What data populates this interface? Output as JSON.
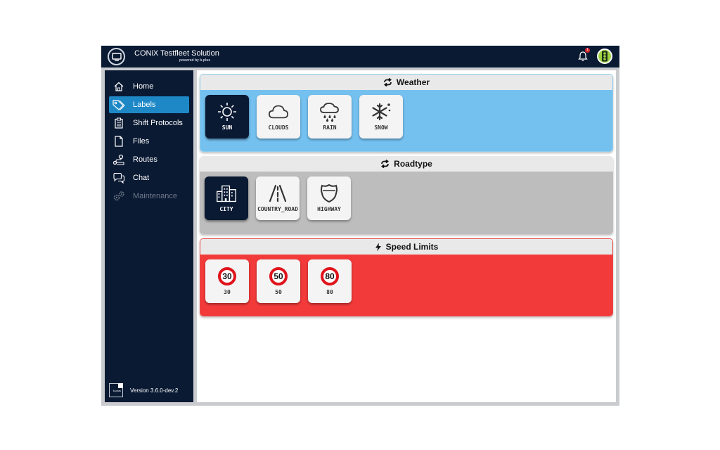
{
  "header": {
    "title": "CONiX Testfleet Solution",
    "subtitle": "powered by b-plus",
    "notification_count": "1"
  },
  "sidebar": {
    "items": [
      {
        "label": "Home",
        "icon": "home-icon",
        "active": false,
        "disabled": false
      },
      {
        "label": "Labels",
        "icon": "tag-icon",
        "active": true,
        "disabled": false
      },
      {
        "label": "Shift Protocols",
        "icon": "clipboard-icon",
        "active": false,
        "disabled": false
      },
      {
        "label": "Files",
        "icon": "file-icon",
        "active": false,
        "disabled": false
      },
      {
        "label": "Routes",
        "icon": "route-icon",
        "active": false,
        "disabled": false
      },
      {
        "label": "Chat",
        "icon": "chat-icon",
        "active": false,
        "disabled": false
      },
      {
        "label": "Maintenance",
        "icon": "gears-icon",
        "active": false,
        "disabled": true
      }
    ],
    "version_logo": "b-plus",
    "version": "Version 3.6.0-dev.2"
  },
  "groups": {
    "weather": {
      "title": "Weather",
      "icon": "sync-icon",
      "color": "#74c1f0",
      "tiles": [
        {
          "label": "SUN",
          "icon": "sun-icon",
          "selected": true
        },
        {
          "label": "CLOUDS",
          "icon": "cloud-icon",
          "selected": false
        },
        {
          "label": "RAIN",
          "icon": "rain-icon",
          "selected": false
        },
        {
          "label": "SNOW",
          "icon": "snow-icon",
          "selected": false
        }
      ]
    },
    "roadtype": {
      "title": "Roadtype",
      "icon": "sync-icon",
      "color": "#bdbdbd",
      "tiles": [
        {
          "label": "CITY",
          "icon": "city-icon",
          "selected": true
        },
        {
          "label": "COUNTRY_ROAD",
          "icon": "road-icon",
          "selected": false
        },
        {
          "label": "HIGHWAY",
          "icon": "highway-shield-icon",
          "selected": false
        }
      ]
    },
    "speed": {
      "title": "Speed Limits",
      "icon": "bolt-icon",
      "color": "#f23a3a",
      "tiles": [
        {
          "label": "30",
          "sign": "30",
          "selected": false
        },
        {
          "label": "50",
          "sign": "50",
          "selected": false
        },
        {
          "label": "80",
          "sign": "80",
          "selected": false
        }
      ]
    }
  }
}
